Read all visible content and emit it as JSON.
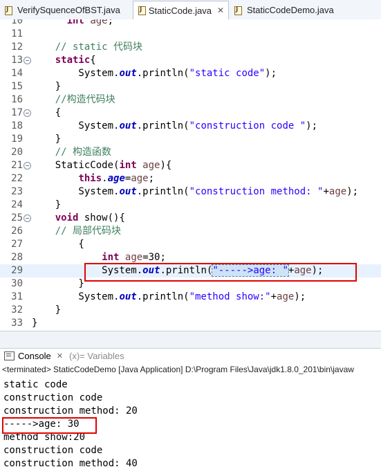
{
  "tabs": [
    {
      "label": "VerifySquenceOfBST.java",
      "active": false
    },
    {
      "label": "StaticCode.java",
      "active": true,
      "close": "✕"
    },
    {
      "label": "StaticCodeDemo.java",
      "active": false
    }
  ],
  "editor": {
    "lines": [
      {
        "num": "10",
        "tokens": [
          [
            "      ",
            ""
          ],
          [
            "int",
            "kw"
          ],
          [
            " ",
            ""
          ],
          [
            "age",
            "var"
          ],
          [
            ";",
            ""
          ]
        ]
      },
      {
        "num": "11",
        "tokens": []
      },
      {
        "num": "12",
        "tokens": [
          [
            "    ",
            ""
          ],
          [
            "// static 代码块",
            "cmt"
          ]
        ]
      },
      {
        "num": "13",
        "fold": "⊖",
        "tokens": [
          [
            "    ",
            ""
          ],
          [
            "static",
            "kw"
          ],
          [
            "{",
            ""
          ]
        ]
      },
      {
        "num": "14",
        "tokens": [
          [
            "        System.",
            ""
          ],
          [
            "out",
            "fld"
          ],
          [
            ".println(",
            ""
          ],
          [
            "\"static code\"",
            "str"
          ],
          [
            ");",
            ""
          ]
        ]
      },
      {
        "num": "15",
        "tokens": [
          [
            "    }",
            ""
          ]
        ]
      },
      {
        "num": "16",
        "tokens": [
          [
            "    ",
            ""
          ],
          [
            "//构造代码块",
            "cmt"
          ]
        ]
      },
      {
        "num": "17",
        "fold": "⊖",
        "tokens": [
          [
            "    {",
            ""
          ]
        ]
      },
      {
        "num": "18",
        "tokens": [
          [
            "        System.",
            ""
          ],
          [
            "out",
            "fld"
          ],
          [
            ".println(",
            ""
          ],
          [
            "\"construction code \"",
            "str"
          ],
          [
            ");",
            ""
          ]
        ]
      },
      {
        "num": "19",
        "tokens": [
          [
            "    }",
            ""
          ]
        ]
      },
      {
        "num": "20",
        "tokens": [
          [
            "    ",
            ""
          ],
          [
            "// 构造函数",
            "cmt"
          ]
        ]
      },
      {
        "num": "21",
        "fold": "⊖",
        "tokens": [
          [
            "    StaticCode(",
            ""
          ],
          [
            "int",
            "kw"
          ],
          [
            " ",
            ""
          ],
          [
            "age",
            "var"
          ],
          [
            "){",
            ""
          ]
        ]
      },
      {
        "num": "22",
        "tokens": [
          [
            "        ",
            ""
          ],
          [
            "this",
            "kw"
          ],
          [
            ".",
            ""
          ],
          [
            "age",
            "fld"
          ],
          [
            "=",
            ""
          ],
          [
            "age",
            "var"
          ],
          [
            ";",
            ""
          ]
        ]
      },
      {
        "num": "23",
        "tokens": [
          [
            "        System.",
            ""
          ],
          [
            "out",
            "fld"
          ],
          [
            ".println(",
            ""
          ],
          [
            "\"construction method: \"",
            "str"
          ],
          [
            "+",
            ""
          ],
          [
            "age",
            "var"
          ],
          [
            ");",
            ""
          ]
        ]
      },
      {
        "num": "24",
        "tokens": [
          [
            "    }",
            ""
          ]
        ]
      },
      {
        "num": "25",
        "fold": "⊖",
        "tokens": [
          [
            "    ",
            ""
          ],
          [
            "void",
            "kw"
          ],
          [
            " show(){",
            ""
          ]
        ]
      },
      {
        "num": "26",
        "tokens": [
          [
            "    ",
            ""
          ],
          [
            "// 局部代码块",
            "cmt"
          ]
        ]
      },
      {
        "num": "27",
        "tokens": [
          [
            "        {",
            ""
          ]
        ]
      },
      {
        "num": "28",
        "tokens": [
          [
            "            ",
            ""
          ],
          [
            "int",
            "kw"
          ],
          [
            " ",
            ""
          ],
          [
            "age",
            "var"
          ],
          [
            "=30;",
            ""
          ]
        ]
      },
      {
        "num": "29",
        "current": true,
        "tokens": [
          [
            "            System.",
            ""
          ],
          [
            "out",
            "fld"
          ],
          [
            ".println(",
            ""
          ],
          [
            "\"----->age: \"",
            "str sel"
          ],
          [
            "+",
            ""
          ],
          [
            "age",
            "var"
          ],
          [
            ");",
            ""
          ]
        ]
      },
      {
        "num": "30",
        "tokens": [
          [
            "        }",
            ""
          ]
        ]
      },
      {
        "num": "31",
        "tokens": [
          [
            "        System.",
            ""
          ],
          [
            "out",
            "fld"
          ],
          [
            ".println(",
            ""
          ],
          [
            "\"method show:\"",
            "str"
          ],
          [
            "+",
            ""
          ],
          [
            "age",
            "var"
          ],
          [
            ");",
            ""
          ]
        ]
      },
      {
        "num": "32",
        "tokens": [
          [
            "    }",
            ""
          ]
        ]
      },
      {
        "num": "33",
        "tokens": [
          [
            "}",
            ""
          ]
        ]
      }
    ]
  },
  "console": {
    "tab_label": "Console",
    "tab_close": "✕",
    "variables_label": "(x)= Variables",
    "status": "<terminated> StaticCodeDemo [Java Application] D:\\Program Files\\Java\\jdk1.8.0_201\\bin\\javaw",
    "output": [
      "static code",
      "construction code",
      "construction method: 20",
      "----->age: 30",
      "method show:20",
      "construction code",
      "construction method: 40"
    ]
  }
}
